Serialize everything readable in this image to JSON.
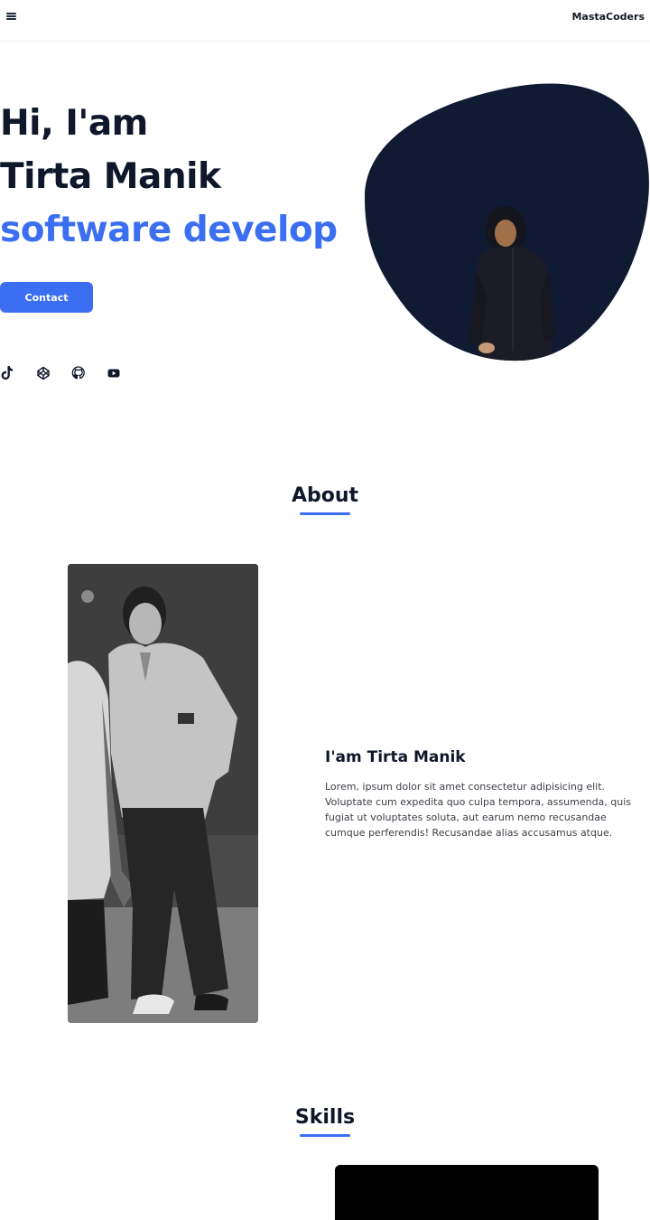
{
  "nav": {
    "menu_icon": "hamburger-menu-icon",
    "brand": "MastaCoders"
  },
  "hero": {
    "line1": "Hi, I'am",
    "line2": "Tirta Manik",
    "line3": "software develop",
    "accent_color": "#3b6ef0",
    "contact_label": "Contact",
    "blob_color": "#111a33"
  },
  "socials": [
    {
      "icon": "tiktok-icon"
    },
    {
      "icon": "codepen-icon"
    },
    {
      "icon": "github-icon"
    },
    {
      "icon": "youtube-icon"
    }
  ],
  "about": {
    "title": "About",
    "heading": "I'am Tirta Manik",
    "text": "Lorem, ipsum dolor sit amet consectetur adipisicing elit. Voluptate cum expedita quo culpa tempora, assumenda, quis fugiat ut voluptates soluta, aut earum nemo recusandae cumque perferendis! Recusandae alias accusamus atque."
  },
  "skills": {
    "title": "Skills"
  }
}
